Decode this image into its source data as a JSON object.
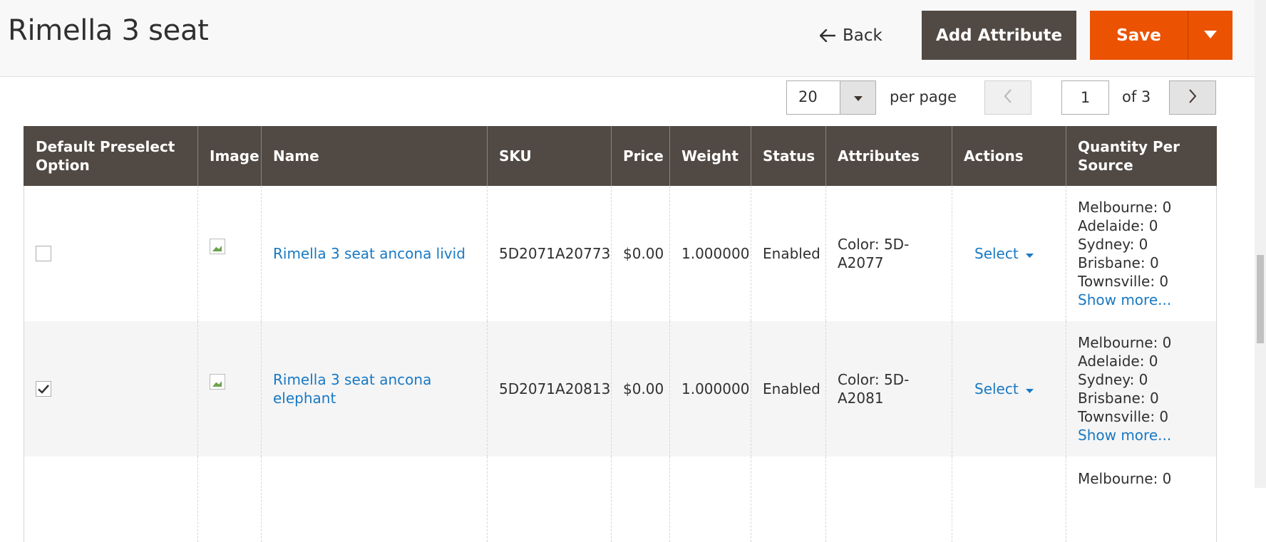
{
  "header": {
    "title": "Rimella 3 seat",
    "back_label": "Back",
    "add_attribute_label": "Add Attribute",
    "save_label": "Save"
  },
  "pager": {
    "per_page_value": "20",
    "per_page_label": "per page",
    "current_page": "1",
    "of_label": "of 3"
  },
  "table": {
    "columns": [
      "Default Preselect Option",
      "Image",
      "Name",
      "SKU",
      "Price",
      "Weight",
      "Status",
      "Attributes",
      "Actions",
      "Quantity Per Source"
    ],
    "rows": [
      {
        "checked": false,
        "name": "Rimella 3 seat ancona livid",
        "sku": "5D2071A20773",
        "price": "$0.00",
        "weight": "1.000000",
        "status": "Enabled",
        "attributes": "Color: 5D-A2077",
        "action": "Select",
        "qty": [
          "Melbourne: 0",
          "Adelaide: 0",
          "Sydney: 0",
          "Brisbane: 0",
          "Townsville: 0"
        ],
        "show_more": "Show more..."
      },
      {
        "checked": true,
        "name": "Rimella 3 seat ancona elephant",
        "sku": "5D2071A20813",
        "price": "$0.00",
        "weight": "1.000000",
        "status": "Enabled",
        "attributes": "Color: 5D-A2081",
        "action": "Select",
        "qty": [
          "Melbourne: 0",
          "Adelaide: 0",
          "Sydney: 0",
          "Brisbane: 0",
          "Townsville: 0"
        ],
        "show_more": "Show more..."
      },
      {
        "qty": [
          "Melbourne: 0"
        ]
      }
    ]
  },
  "colors": {
    "header_bg": "#514943",
    "primary": "#eb5202",
    "link": "#1979c3"
  }
}
